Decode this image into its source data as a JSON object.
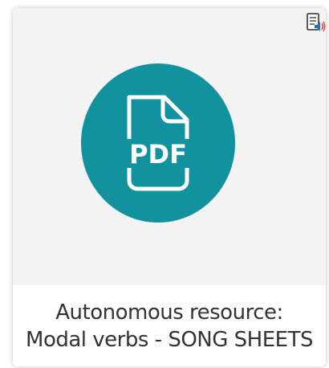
{
  "card": {
    "title_line1": "Autonomous resource:",
    "title_line2": "Modal verbs - SONG SHEETS",
    "file_type_label": "PDF",
    "file_icon": "pdf-file-icon",
    "audio_icon": "audio-document-icon",
    "accent_color": "#12919f"
  }
}
